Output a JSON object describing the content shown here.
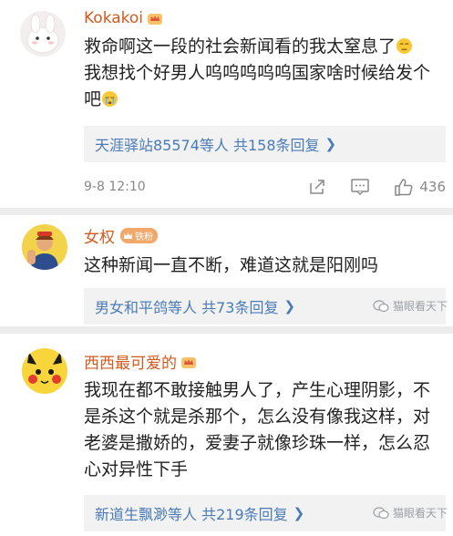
{
  "comments": [
    {
      "username": "Kokakoi",
      "text": "救命啊这一段的社会新闻看的我太窒息了",
      "text2": "我想找个好男人呜呜呜呜呜国家啥时候给发个吧",
      "reply_summary": "天涯驿站85574等人 共158条回复",
      "time": "9-8 12:10",
      "likes": "436"
    },
    {
      "username": "女权",
      "badge": "铁粉",
      "text": "这种新闻一直不断，难道这就是阳刚吗",
      "reply_summary": "男女和平鸽等人 共73条回复"
    },
    {
      "username": "西西最可爱的",
      "text": "我现在都不敢接触男人了，产生心理阴影，不是杀这个就是杀那个，怎么没有像我这样，对老婆是撒娇的，爱妻子就像珍珠一样，怎么忍心对异性下手",
      "reply_summary": "新道生飘渺等人 共219条回复"
    }
  ],
  "watermark": "猫眼看天下",
  "colors": {
    "username": "#d35a1e",
    "link": "#4a7bb7",
    "reply_bg": "#f2f2f2",
    "meta": "#888888"
  }
}
